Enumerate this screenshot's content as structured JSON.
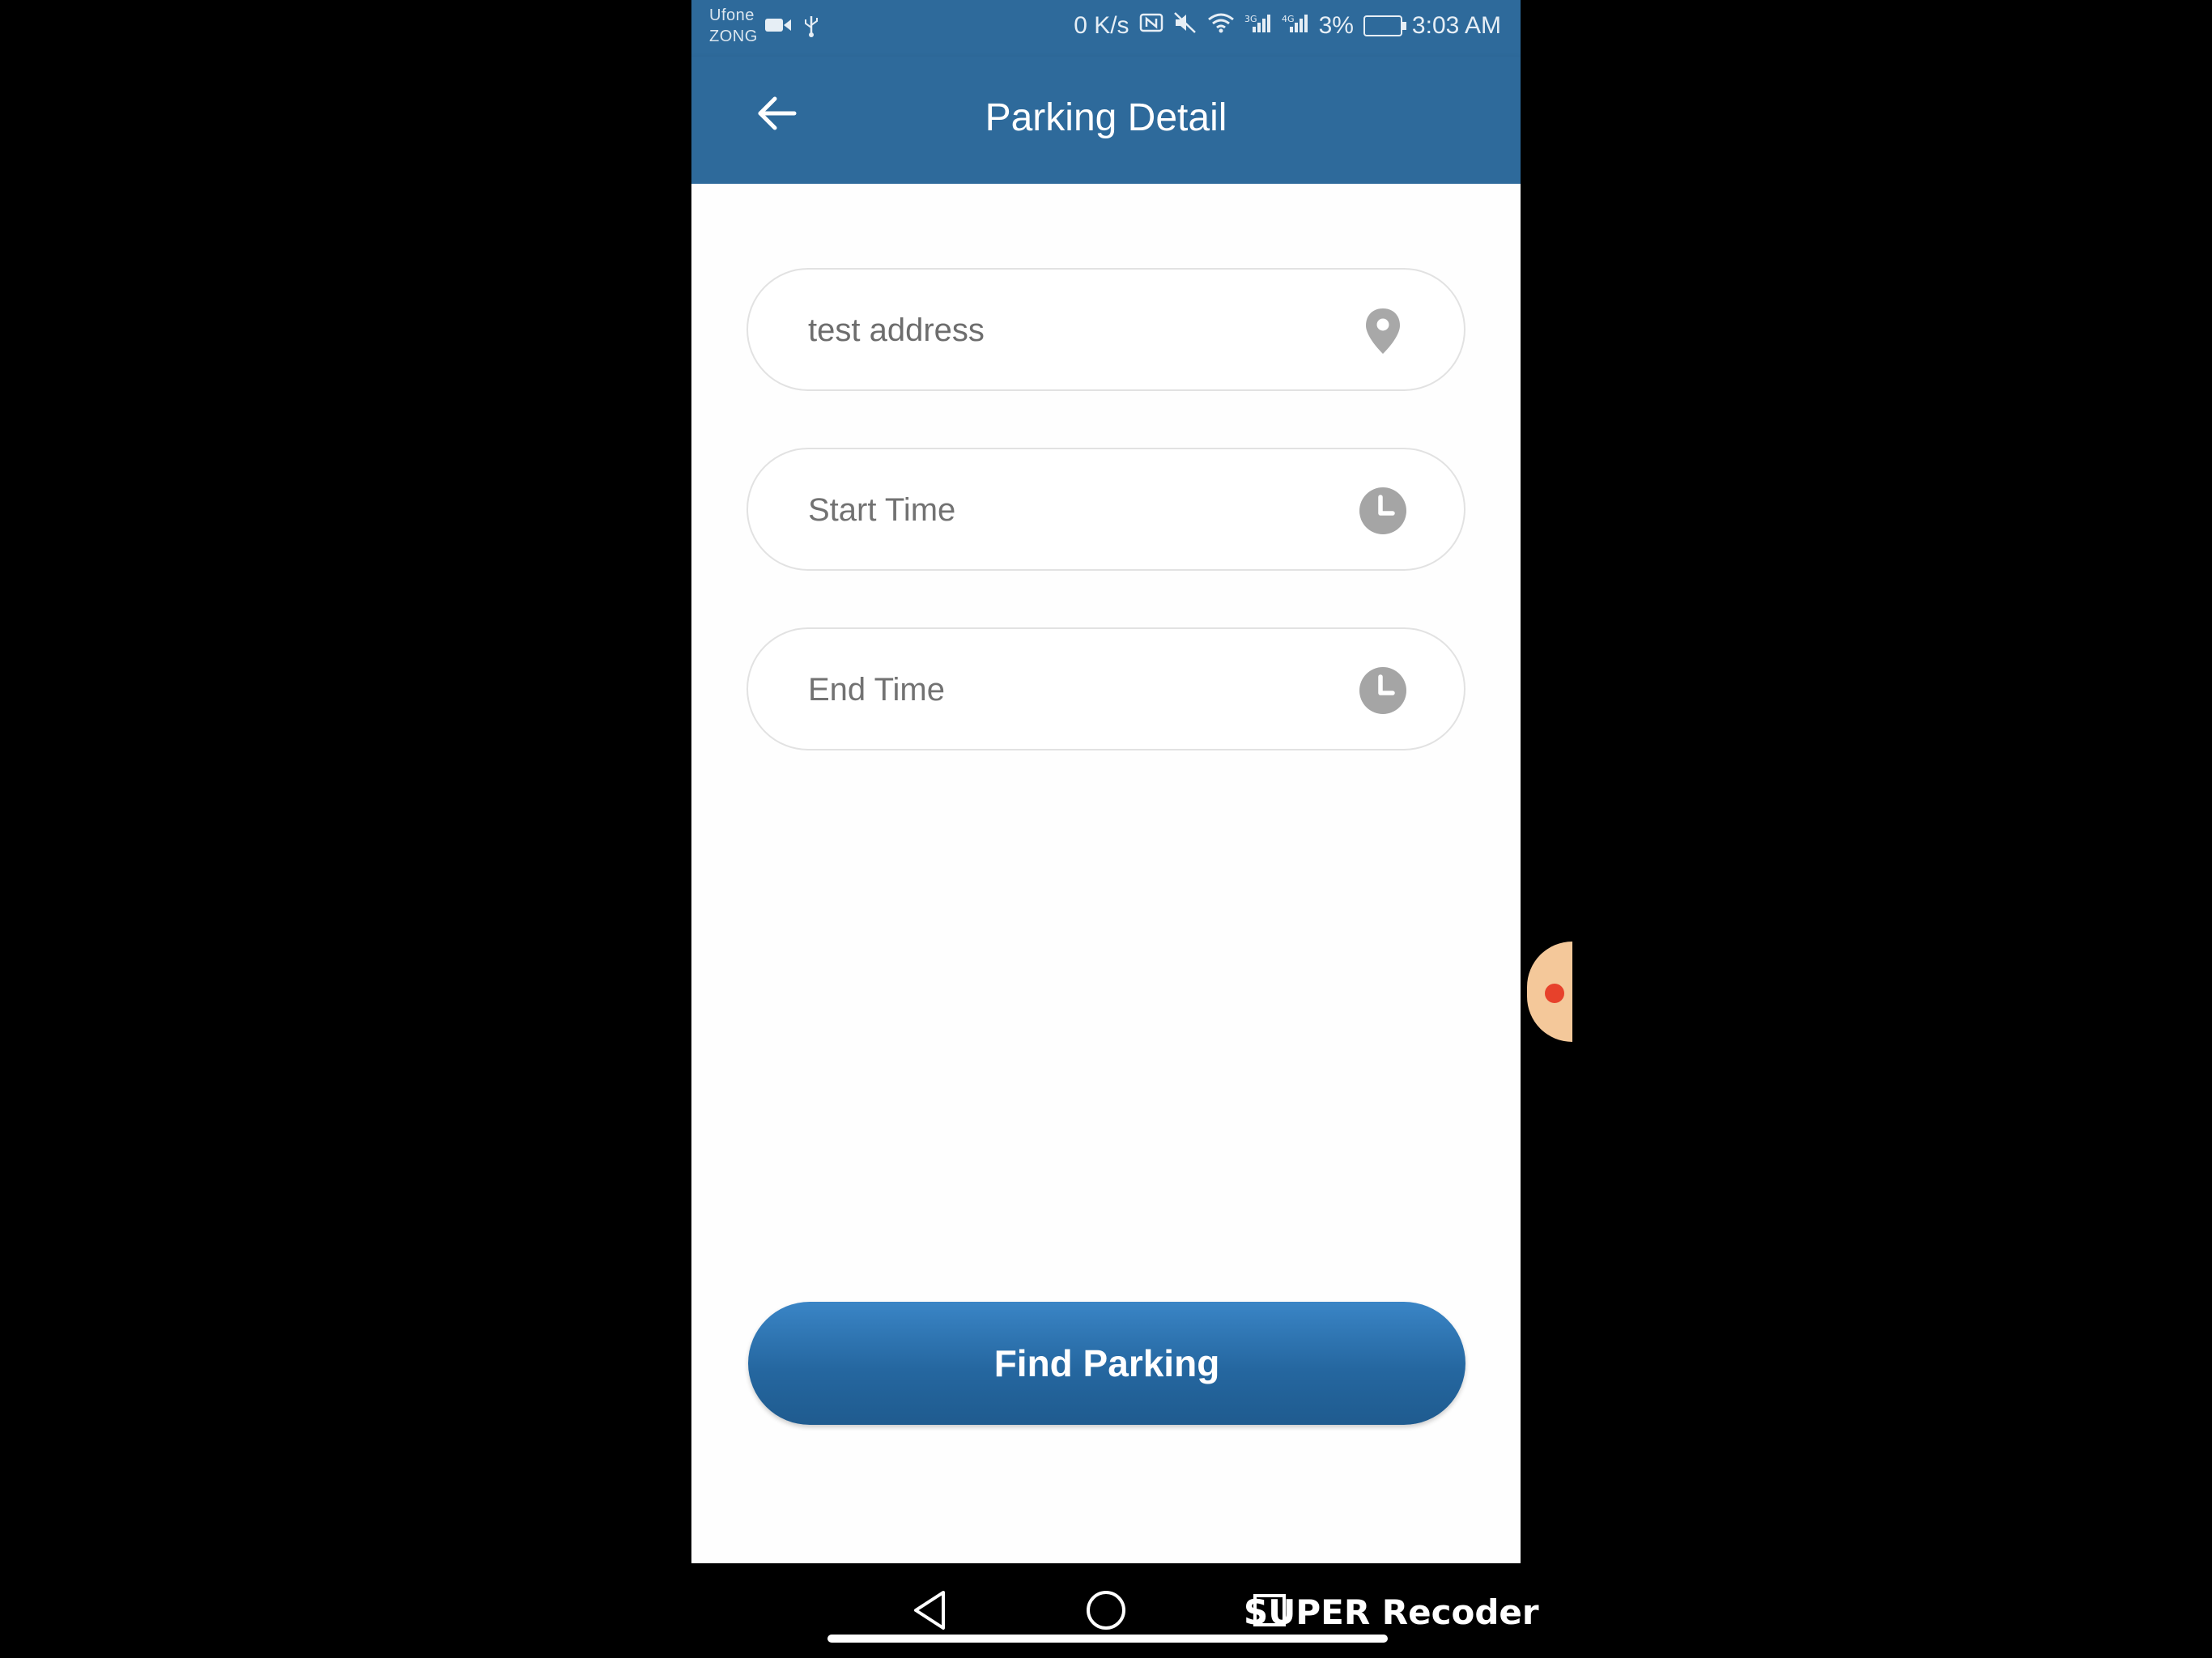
{
  "status_bar": {
    "carrier_top": "Ufone",
    "carrier_bottom": "ZONG",
    "network_speed": "0 K/s",
    "battery": "3%",
    "time": "3:03 AM"
  },
  "app_bar": {
    "title": "Parking Detail",
    "back_icon": "arrow-left-icon"
  },
  "form": {
    "address": {
      "value": "test address",
      "icon": "location-pin-icon"
    },
    "start_time": {
      "placeholder": "Start Time",
      "icon": "clock-icon"
    },
    "end_time": {
      "placeholder": "End Time",
      "icon": "clock-icon"
    }
  },
  "actions": {
    "find_parking_label": "Find Parking"
  },
  "overlay": {
    "watermark": "SUPER Recoder"
  },
  "colors": {
    "primary": "#2e6a9b",
    "button": "#2567a0",
    "field_border": "#e2e2e2",
    "icon_grey": "#a5a5a5"
  }
}
